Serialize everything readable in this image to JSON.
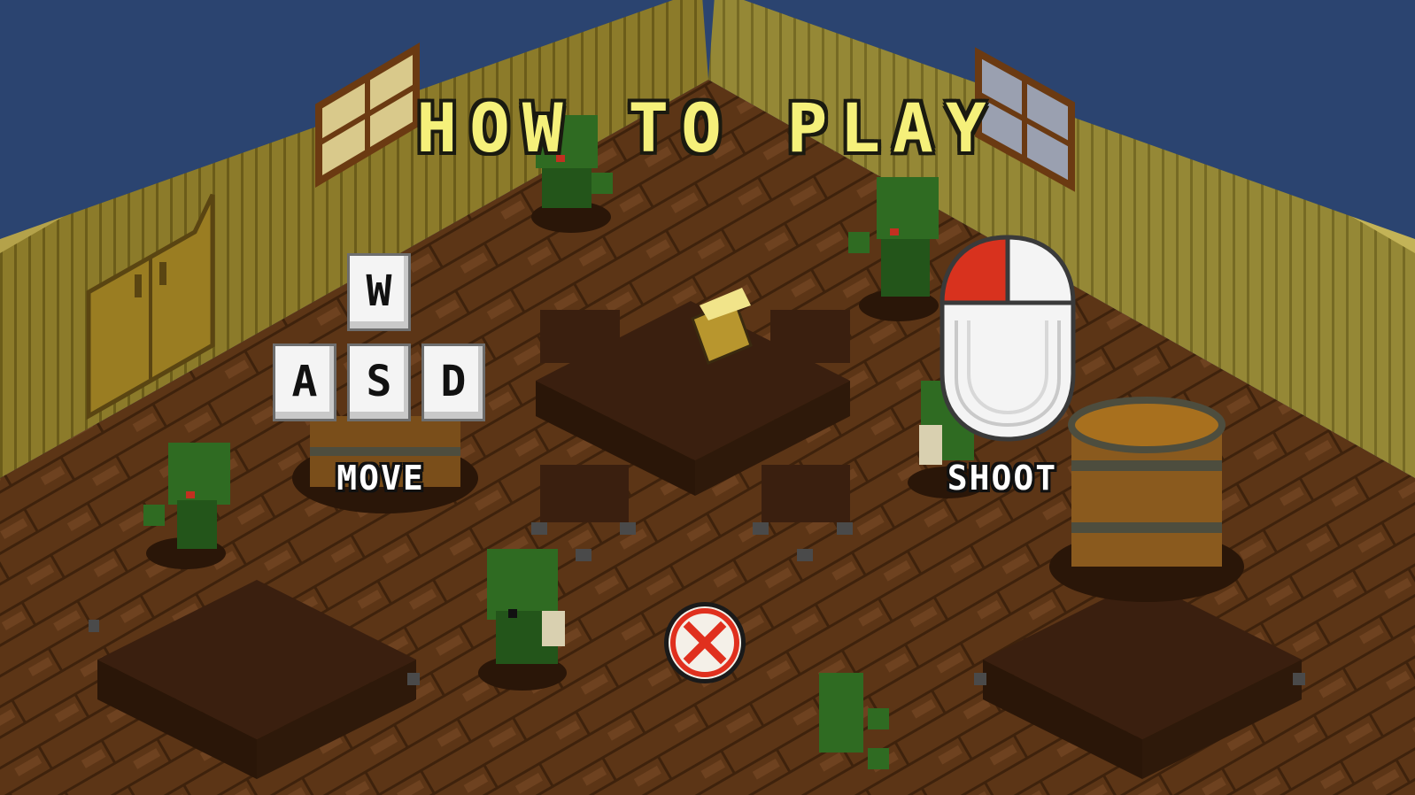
{
  "title": "HOW TO PLAY",
  "controls": {
    "move": {
      "keys": {
        "up": "W",
        "left": "A",
        "down": "S",
        "right": "D"
      },
      "label": "MOVE"
    },
    "shoot": {
      "label": "SHOOT",
      "highlighted_button": "left"
    }
  },
  "close_button": {
    "icon": "close-icon"
  },
  "colors": {
    "title": "#f5f07a",
    "background": "#2b4470",
    "wall": "#8a7a2a",
    "floor": "#5a3414",
    "mouse_highlight": "#d8321e",
    "close": "#e0301e"
  }
}
